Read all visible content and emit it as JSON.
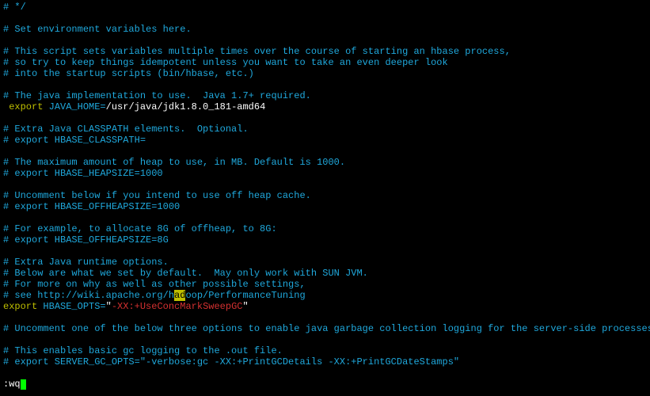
{
  "lines": {
    "l01": "# */",
    "l02": "# Set environment variables here.",
    "l03": "# This script sets variables multiple times over the course of starting an hbase process,",
    "l04": "# so try to keep things idempotent unless you want to take an even deeper look",
    "l05": "# into the startup scripts (bin/hbase, etc.)",
    "l06": "# The java implementation to use.  Java 1.7+ required.",
    "l07_sp": " ",
    "l07_kw": "export",
    "l07_var": " JAVA_HOME=",
    "l07_val": "/usr/java/jdk1.8.0_181-amd64",
    "l08": "# Extra Java CLASSPATH elements.  Optional.",
    "l09": "# export HBASE_CLASSPATH=",
    "l10": "# The maximum amount of heap to use, in MB. Default is 1000.",
    "l11": "# export HBASE_HEAPSIZE=1000",
    "l12": "# Uncomment below if you intend to use off heap cache.",
    "l13": "# export HBASE_OFFHEAPSIZE=1000",
    "l14": "# For example, to allocate 8G of offheap, to 8G:",
    "l15": "# export HBASE_OFFHEAPSIZE=8G",
    "l16": "# Extra Java runtime options.",
    "l17": "# Below are what we set by default.  May only work with SUN JVM.",
    "l18": "# For more on why as well as other possible settings,",
    "l19a": "# see http://wiki.apache.org/h",
    "l19b": "ad",
    "l19c": "oop/PerformanceTuning",
    "l20_kw": "export",
    "l20_var": " HBASE_OPTS=",
    "l20_q1": "\"",
    "l20_val": "-XX:+UseConcMarkSweepGC",
    "l20_q2": "\"",
    "l21": "# Uncomment one of the below three options to enable java garbage collection logging for the server-side processes.",
    "l22": "# This enables basic gc logging to the .out file.",
    "l23": "# export SERVER_GC_OPTS=\"-verbose:gc -XX:+PrintGCDetails -XX:+PrintGCDateStamps\"",
    "cmd": ":wq"
  }
}
